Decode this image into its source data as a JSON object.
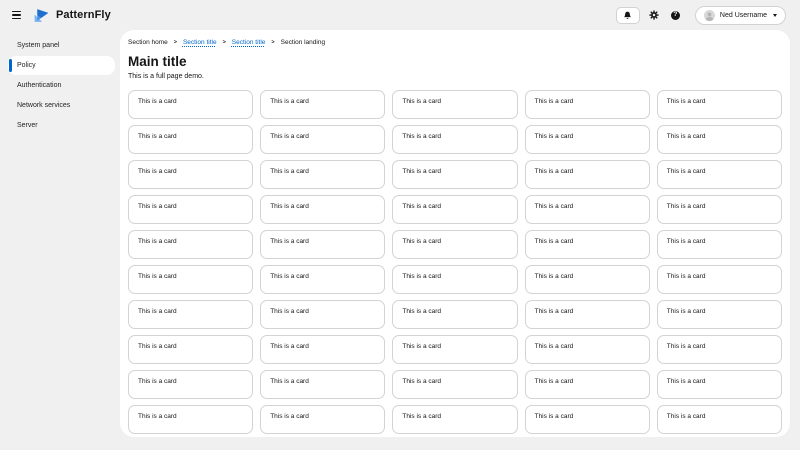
{
  "colors": {
    "accent": "#0066cc",
    "page_background": "#f0f0f0",
    "panel_background": "#ffffff",
    "card_border": "#d3d3d3",
    "text": "#151515"
  },
  "masthead": {
    "brand": "PatternFly",
    "icons": {
      "menu": "hamburger-icon",
      "notifications": "bell-icon",
      "settings": "gear-icon",
      "help": "question-circle-icon",
      "user_chevron": "chevron-down-icon"
    },
    "user": {
      "name": "Ned Username"
    }
  },
  "sidebar": {
    "items": [
      {
        "label": "System panel",
        "selected": false
      },
      {
        "label": "Policy",
        "selected": true
      },
      {
        "label": "Authentication",
        "selected": false
      },
      {
        "label": "Network services",
        "selected": false
      },
      {
        "label": "Server",
        "selected": false
      }
    ]
  },
  "breadcrumb": {
    "separator": ">",
    "items": [
      {
        "label": "Section home",
        "style": "plain"
      },
      {
        "label": "Section title",
        "style": "link"
      },
      {
        "label": "Section title",
        "style": "link"
      },
      {
        "label": "Section landing",
        "style": "current"
      }
    ]
  },
  "main": {
    "title": "Main title",
    "subtitle": "This is a full page demo."
  },
  "cards": {
    "label": "This is a card",
    "rows": 10,
    "columns": 5
  }
}
